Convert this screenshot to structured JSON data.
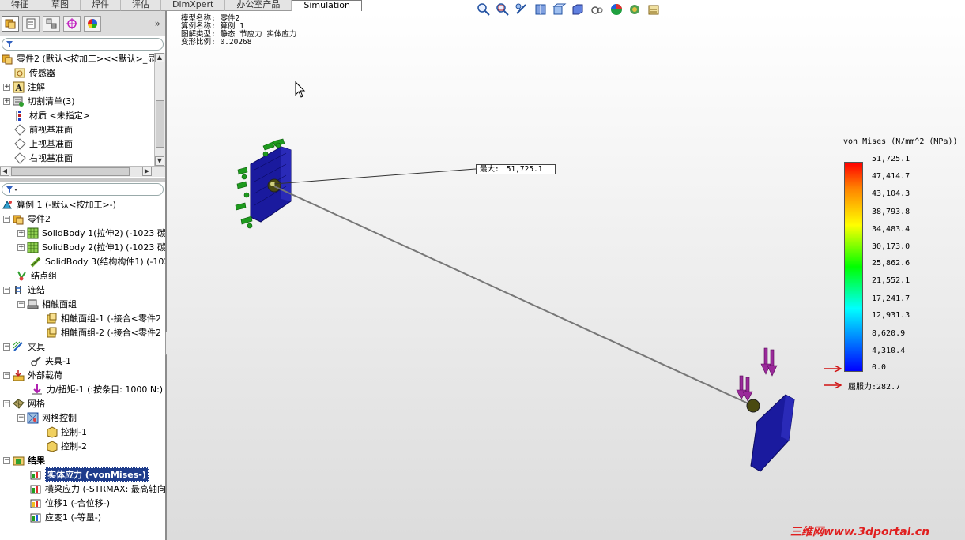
{
  "tabs": [
    "特征",
    "草图",
    "焊件",
    "评估",
    "DimXpert",
    "办公室产品",
    "Simulation"
  ],
  "feature_tree": {
    "root": "零件2 (默认<按加工><<默认>_显",
    "items": [
      "传感器",
      "注解",
      "切割清单(3)",
      "材质 <未指定>",
      "前视基准面",
      "上视基准面",
      "右视基准面"
    ]
  },
  "sim_tree": {
    "study": "算例 1 (-默认<按加工>-)",
    "part": "零件2",
    "bodies": [
      "SolidBody 1(拉伸2) (-1023 碳钢",
      "SolidBody 2(拉伸1) (-1023 碳钢",
      "SolidBody 3(结构构件1) (-1023"
    ],
    "joint_group": "结点组",
    "connections": "连结",
    "contact_set": "相触面组",
    "contacts": [
      "相触面组-1 (-接合<零件2",
      "相触面组-2 (-接合<零件2"
    ],
    "fixtures": "夹具",
    "fixture_1": "夹具-1",
    "external_loads": "外部载荷",
    "force_1": "力/扭矩-1 (:按条目: 1000 N:)",
    "mesh": "网格",
    "mesh_control": "网格控制",
    "controls": [
      "控制-1",
      "控制-2"
    ],
    "results": "结果",
    "result_items": [
      "实体应力 (-vonMises-)",
      "横梁应力 (-STRMAX: 最高轴向",
      "位移1 (-合位移-)",
      "应变1 (-等量-)"
    ]
  },
  "info": {
    "model": "模型名称: 零件2",
    "study": "算例名称: 算例 1",
    "plot": "图解类型: 静态 节应力 实体应力",
    "scale": "变形比例: 0.20268"
  },
  "legend": {
    "title": "von Mises (N/mm^2 (MPa))",
    "values": [
      "51,725.1",
      "47,414.7",
      "43,104.3",
      "38,793.8",
      "34,483.4",
      "30,173.0",
      "25,862.6",
      "21,552.1",
      "17,241.7",
      "12,931.3",
      "8,620.9",
      "4,310.4",
      "0.0"
    ],
    "yield": "屈服力:282.7"
  },
  "max_label": {
    "tag": "最大:",
    "value": "51,725.1"
  },
  "watermark": "三维网www.3dportal.cn",
  "colors": {
    "mesh_blue": "#1a1a9e",
    "fixture_green": "#1e9a1e",
    "load_purple": "#9a2a9a",
    "selection": "#1e3c8c"
  }
}
